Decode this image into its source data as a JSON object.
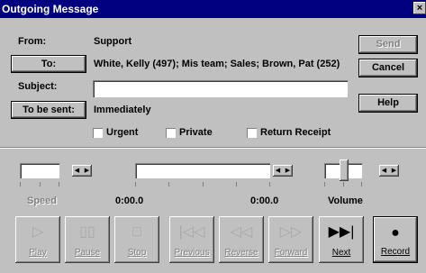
{
  "window": {
    "title": "Outgoing Message",
    "close": "×"
  },
  "fields": {
    "from_label": "From:",
    "from_value": "Support",
    "to_button": "To:",
    "to_value": "White, Kelly (497); Mis team; Sales; Brown, Pat (252)",
    "subject_label": "Subject:",
    "subject_value": "",
    "to_be_sent_button": "To be sent:",
    "to_be_sent_value": "Immediately"
  },
  "side_buttons": {
    "send": "Send",
    "cancel": "Cancel",
    "help": "Help"
  },
  "options": {
    "urgent": "Urgent",
    "private": "Private",
    "return_receipt": "Return Receipt"
  },
  "media": {
    "speed_label": "Speed",
    "time_left": "0:00.0",
    "time_right": "0:00.0",
    "volume_label": "Volume"
  },
  "transport": [
    {
      "label": "Play",
      "icon": "play-icon",
      "glyph": "▷",
      "enabled": false
    },
    {
      "label": "Pause",
      "icon": "pause-icon",
      "glyph": "▯▯",
      "enabled": false
    },
    {
      "label": "Stop",
      "icon": "stop-icon",
      "glyph": "□",
      "enabled": false
    },
    {
      "label": "Previous",
      "icon": "previous-icon",
      "glyph": "|◁◁",
      "enabled": false
    },
    {
      "label": "Reverse",
      "icon": "reverse-icon",
      "glyph": "◁◁",
      "enabled": false
    },
    {
      "label": "Forward",
      "icon": "forward-icon",
      "glyph": "▷▷",
      "enabled": false
    },
    {
      "label": "Next",
      "icon": "next-icon",
      "glyph": "▶▶|",
      "enabled": true
    },
    {
      "label": "Record",
      "icon": "record-icon",
      "glyph": "●",
      "enabled": true
    }
  ]
}
